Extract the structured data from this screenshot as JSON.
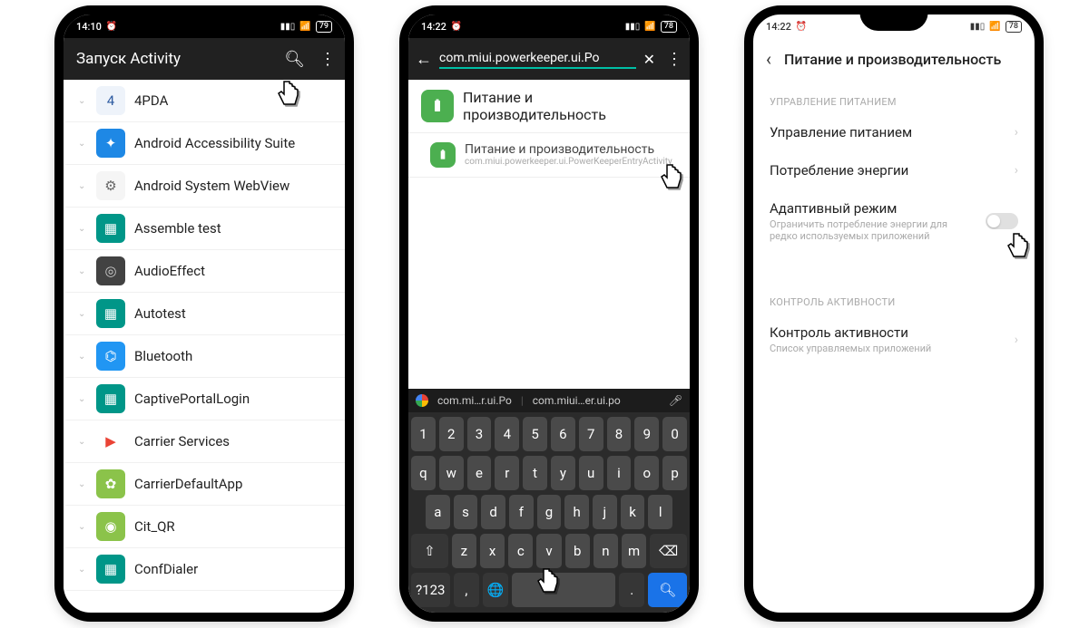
{
  "phone1": {
    "status": {
      "time": "14:10",
      "battery": "79"
    },
    "header_title": "Запуск Activity",
    "apps": [
      {
        "name": "4PDA",
        "bg": "#eef3fa",
        "fg": "#2c5aa0",
        "glyph": "4"
      },
      {
        "name": "Android Accessibility Suite",
        "bg": "#1e88e5",
        "fg": "#fff",
        "glyph": "✦"
      },
      {
        "name": "Android System WebView",
        "bg": "#f5f5f5",
        "fg": "#666",
        "glyph": "⚙"
      },
      {
        "name": "Assemble test",
        "bg": "#009688",
        "fg": "#fff",
        "glyph": "▦"
      },
      {
        "name": "AudioEffect",
        "bg": "#424242",
        "fg": "#ccc",
        "glyph": "◎"
      },
      {
        "name": "Autotest",
        "bg": "#009688",
        "fg": "#fff",
        "glyph": "▦"
      },
      {
        "name": "Bluetooth",
        "bg": "#2196f3",
        "fg": "#fff",
        "glyph": "⌬"
      },
      {
        "name": "CaptivePortalLogin",
        "bg": "#009688",
        "fg": "#fff",
        "glyph": "▦"
      },
      {
        "name": "Carrier Services",
        "bg": "#fff",
        "fg": "#ea4335",
        "glyph": "▶"
      },
      {
        "name": "CarrierDefaultApp",
        "bg": "#8bc34a",
        "fg": "#fff",
        "glyph": "✿"
      },
      {
        "name": "Cit_QR",
        "bg": "#8bc34a",
        "fg": "#fff",
        "glyph": "◉"
      },
      {
        "name": "ConfDialer",
        "bg": "#009688",
        "fg": "#fff",
        "glyph": "▦"
      }
    ]
  },
  "phone2": {
    "status": {
      "time": "14:22",
      "battery": "78"
    },
    "search_text": "com.miui.powerkeeper.ui.Po",
    "result_title": "Питание и производительность",
    "sub_title": "Питание и производительность",
    "sub_path": "com.miui.powerkeeper.ui.PowerKeeperEntryActivity",
    "suggestions": [
      "com.mi…r.ui.Po",
      "com.miui…er.ui.po"
    ],
    "rows": [
      [
        "1",
        "2",
        "3",
        "4",
        "5",
        "6",
        "7",
        "8",
        "9",
        "0"
      ],
      [
        "q",
        "w",
        "e",
        "r",
        "t",
        "y",
        "u",
        "i",
        "o",
        "p"
      ],
      [
        "a",
        "s",
        "d",
        "f",
        "g",
        "h",
        "j",
        "k",
        "l"
      ],
      [
        "z",
        "x",
        "c",
        "v",
        "b",
        "n",
        "m"
      ]
    ],
    "shift": "⇧",
    "bksp": "⌫",
    "nums": "?123",
    "comma": ",",
    "lang": "🌐",
    "period": "."
  },
  "phone3": {
    "status": {
      "time": "14:22",
      "battery": "78"
    },
    "header_title": "Питание и производительность",
    "sec1": "УПРАВЛЕНИЕ ПИТАНИЕМ",
    "items1": [
      {
        "l": "Управление питанием"
      },
      {
        "l": "Потребление энергии"
      }
    ],
    "adaptive": {
      "l": "Адаптивный режим",
      "s": "Ограничить потребление энергии для редко используемых приложений"
    },
    "sec2": "КОНТРОЛЬ АКТИВНОСТИ",
    "item2": {
      "l": "Контроль активности",
      "s": "Список управляемых приложений"
    }
  }
}
